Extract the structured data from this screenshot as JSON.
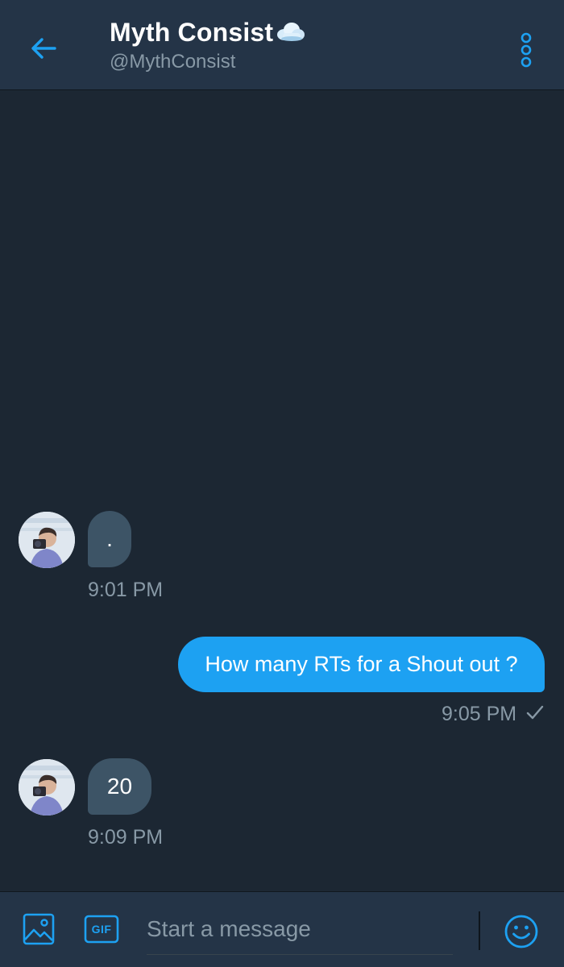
{
  "header": {
    "name": "Myth Consist",
    "handle": "@MythConsist",
    "icons": {
      "back": "arrow-left-icon",
      "badge": "cloud-emoji-icon",
      "more": "vertical-dots-icon"
    }
  },
  "messages": [
    {
      "direction": "incoming",
      "text": ".",
      "time": "9:01 PM"
    },
    {
      "direction": "outgoing",
      "text": "How many RTs for a Shout out ?",
      "time": "9:05 PM",
      "status": "sent-check"
    },
    {
      "direction": "incoming",
      "text": "20",
      "time": "9:09 PM"
    }
  ],
  "composer": {
    "placeholder": "Start a message",
    "gif_label": "GIF",
    "icons": {
      "media": "image-icon",
      "gif": "gif-icon",
      "emoji": "smiley-icon"
    }
  },
  "colors": {
    "background": "#1c2733",
    "header": "#243447",
    "accent": "#1da1f2",
    "incoming_bubble": "#3d5466",
    "secondary_text": "#8899a6"
  }
}
